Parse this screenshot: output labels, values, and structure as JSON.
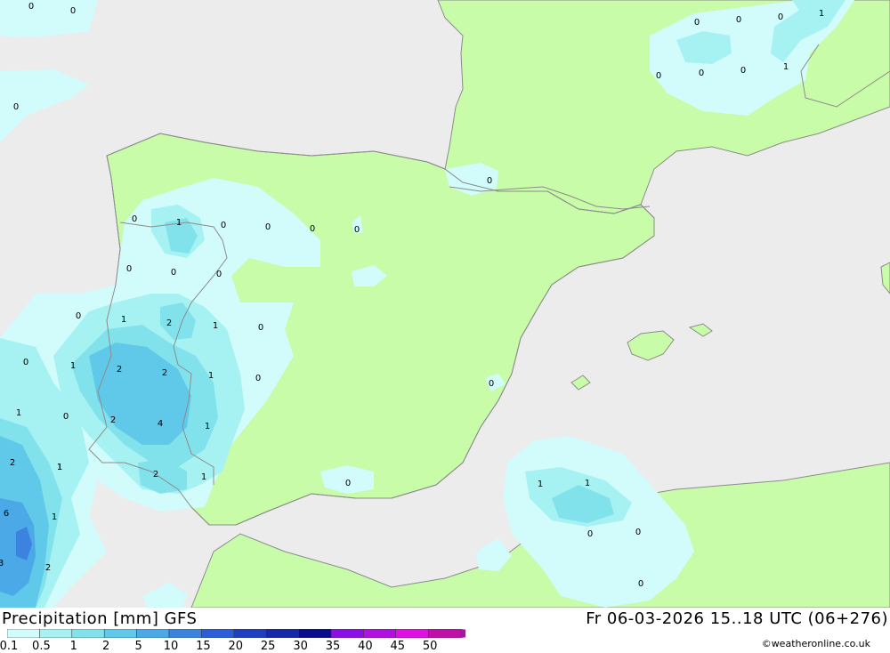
{
  "colors": {
    "sea": "#ececec",
    "land": "#c8fca8",
    "border": "#8c8c8c",
    "precip_0_1": "#d2fbfb",
    "precip_0_5": "#a6f2f2",
    "precip_1": "#82e2ec",
    "precip_2": "#60c8e8",
    "precip_5": "#4aa9e6",
    "precip_10": "#3c83e0"
  },
  "header": {
    "title": "Precipitation [mm]  GFS",
    "timestamp": "Fr 06-03-2026 15..18 UTC (06+276)",
    "credit": "©weatheronline.co.uk"
  },
  "legend": {
    "labels": [
      "0.1",
      "0.5",
      "1",
      "2",
      "5",
      "10",
      "15",
      "20",
      "25",
      "30",
      "35",
      "40",
      "45",
      "50"
    ],
    "colors": [
      "#d2fbfb",
      "#a6f2f2",
      "#82e2ec",
      "#60c8e8",
      "#4aa9e6",
      "#3c83e0",
      "#2a5fd8",
      "#1f3fc0",
      "#1428a8",
      "#0a0a8c",
      "#8a10e6",
      "#b010e0",
      "#e010e0",
      "#c010a8",
      "#a0189c"
    ]
  },
  "map_values": {
    "labels": [
      "0",
      "0",
      "0",
      "0",
      "0",
      "1",
      "0",
      "0",
      "0",
      "1",
      "0",
      "0",
      "0",
      "1",
      "0",
      "0",
      "0",
      "0",
      "0",
      "0",
      "0",
      "1",
      "2",
      "1",
      "0",
      "0",
      "1",
      "2",
      "2",
      "1",
      "0",
      "0",
      "1",
      "0",
      "2",
      "4",
      "1",
      "0",
      "2",
      "1",
      "2",
      "1",
      "1",
      "6",
      "1",
      "3",
      "2",
      "0",
      "1",
      "1",
      "0",
      "0",
      "0"
    ]
  }
}
